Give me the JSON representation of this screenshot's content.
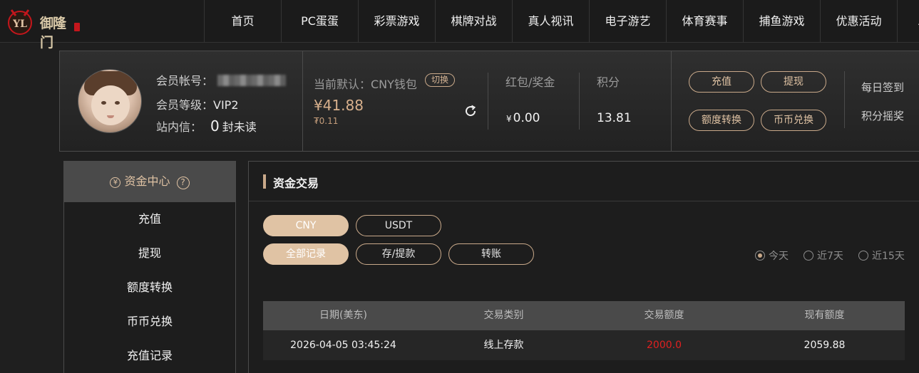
{
  "brand": {
    "name": "御隆门"
  },
  "nav": {
    "items": [
      "首页",
      "PC蛋蛋",
      "彩票游戏",
      "棋牌对战",
      "真人视讯",
      "电子游艺",
      "体育赛事",
      "捕鱼游戏",
      "优惠活动",
      "A"
    ]
  },
  "user": {
    "account_label": "会员帐号：",
    "level_label": "会员等级：",
    "level_value": "VIP2",
    "message_label": "站内信：",
    "message_count": "0",
    "message_unit": "封未读"
  },
  "wallet": {
    "label": "当前默认：CNY钱包",
    "switch_label": "切换",
    "balance": "¥41.88",
    "sub_balance": "₮0.11"
  },
  "stats": {
    "bonus_label": "红包/奖金",
    "bonus_currency": "¥",
    "bonus_value": "0.00",
    "points_label": "积分",
    "points_value": "13.81"
  },
  "actions": {
    "deposit": "充值",
    "withdraw": "提现",
    "transfer": "额度转换",
    "exchange": "币币兑换",
    "checkin": "每日签到",
    "lottery": "积分摇奖"
  },
  "sidebar": {
    "title": "资金中心",
    "yen_glyph": "¥",
    "help_glyph": "?",
    "items": [
      "充值",
      "提现",
      "额度转换",
      "币币兑换",
      "充值记录"
    ]
  },
  "main": {
    "title": "资金交易",
    "currency_tabs": [
      "CNY",
      "USDT"
    ],
    "type_tabs": [
      "全部记录",
      "存/提款",
      "转账"
    ],
    "ranges": [
      "今天",
      "近7天",
      "近15天"
    ],
    "table": {
      "headers": [
        "日期(美东)",
        "交易类别",
        "交易额度",
        "现有额度"
      ],
      "rows": [
        {
          "date": "2026-04-05 03:45:24",
          "type": "线上存款",
          "amount": "2000.0",
          "balance": "2059.88"
        }
      ]
    }
  },
  "colors": {
    "accent": "#e0c3a4",
    "background": "#1f1f1f",
    "amount_red": "#e02020"
  }
}
